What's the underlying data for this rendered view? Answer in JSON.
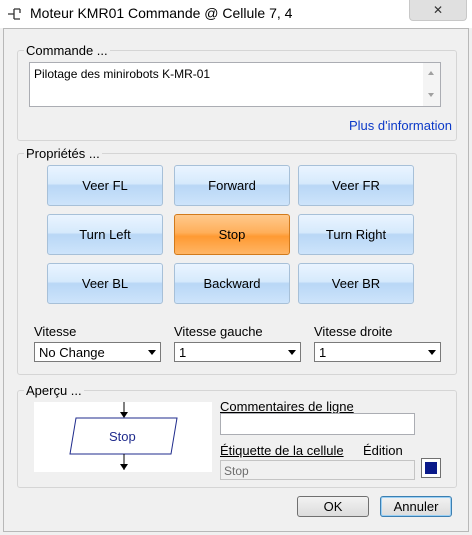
{
  "window": {
    "title": "Moteur KMR01 Commande @ Cellule 7, 4",
    "close_glyph": "✕"
  },
  "command": {
    "group_label": "Commande ...",
    "text": "Pilotage des minirobots K-MR-01",
    "more_info_link": "Plus d'information"
  },
  "properties": {
    "group_label": "Propriétés ...",
    "buttons": [
      {
        "label": "Veer FL"
      },
      {
        "label": "Forward"
      },
      {
        "label": "Veer FR"
      },
      {
        "label": "Turn Left"
      },
      {
        "label": "Stop"
      },
      {
        "label": "Turn Right"
      },
      {
        "label": "Veer BL"
      },
      {
        "label": "Backward"
      },
      {
        "label": "Veer BR"
      }
    ],
    "selected": "Stop",
    "speed": {
      "label": "Vitesse",
      "value": "No Change"
    },
    "speed_left": {
      "label": "Vitesse gauche",
      "value": "1"
    },
    "speed_right": {
      "label": "Vitesse droite",
      "value": "1"
    }
  },
  "preview": {
    "group_label": "Aperçu ...",
    "block_label": "Stop",
    "line_comment_label": "Commentaires de ligne",
    "line_comment_value": "",
    "cell_label_label": "Étiquette de la cellule",
    "edit_label": "Édition",
    "cell_label_value": "Stop",
    "swatch_color": "#0a1a8a"
  },
  "dialog": {
    "ok_label": "OK",
    "cancel_label": "Annuler"
  },
  "colors": {
    "active_button": "#ff9a33",
    "button": "#cde4fb",
    "link": "#0b39c8"
  }
}
